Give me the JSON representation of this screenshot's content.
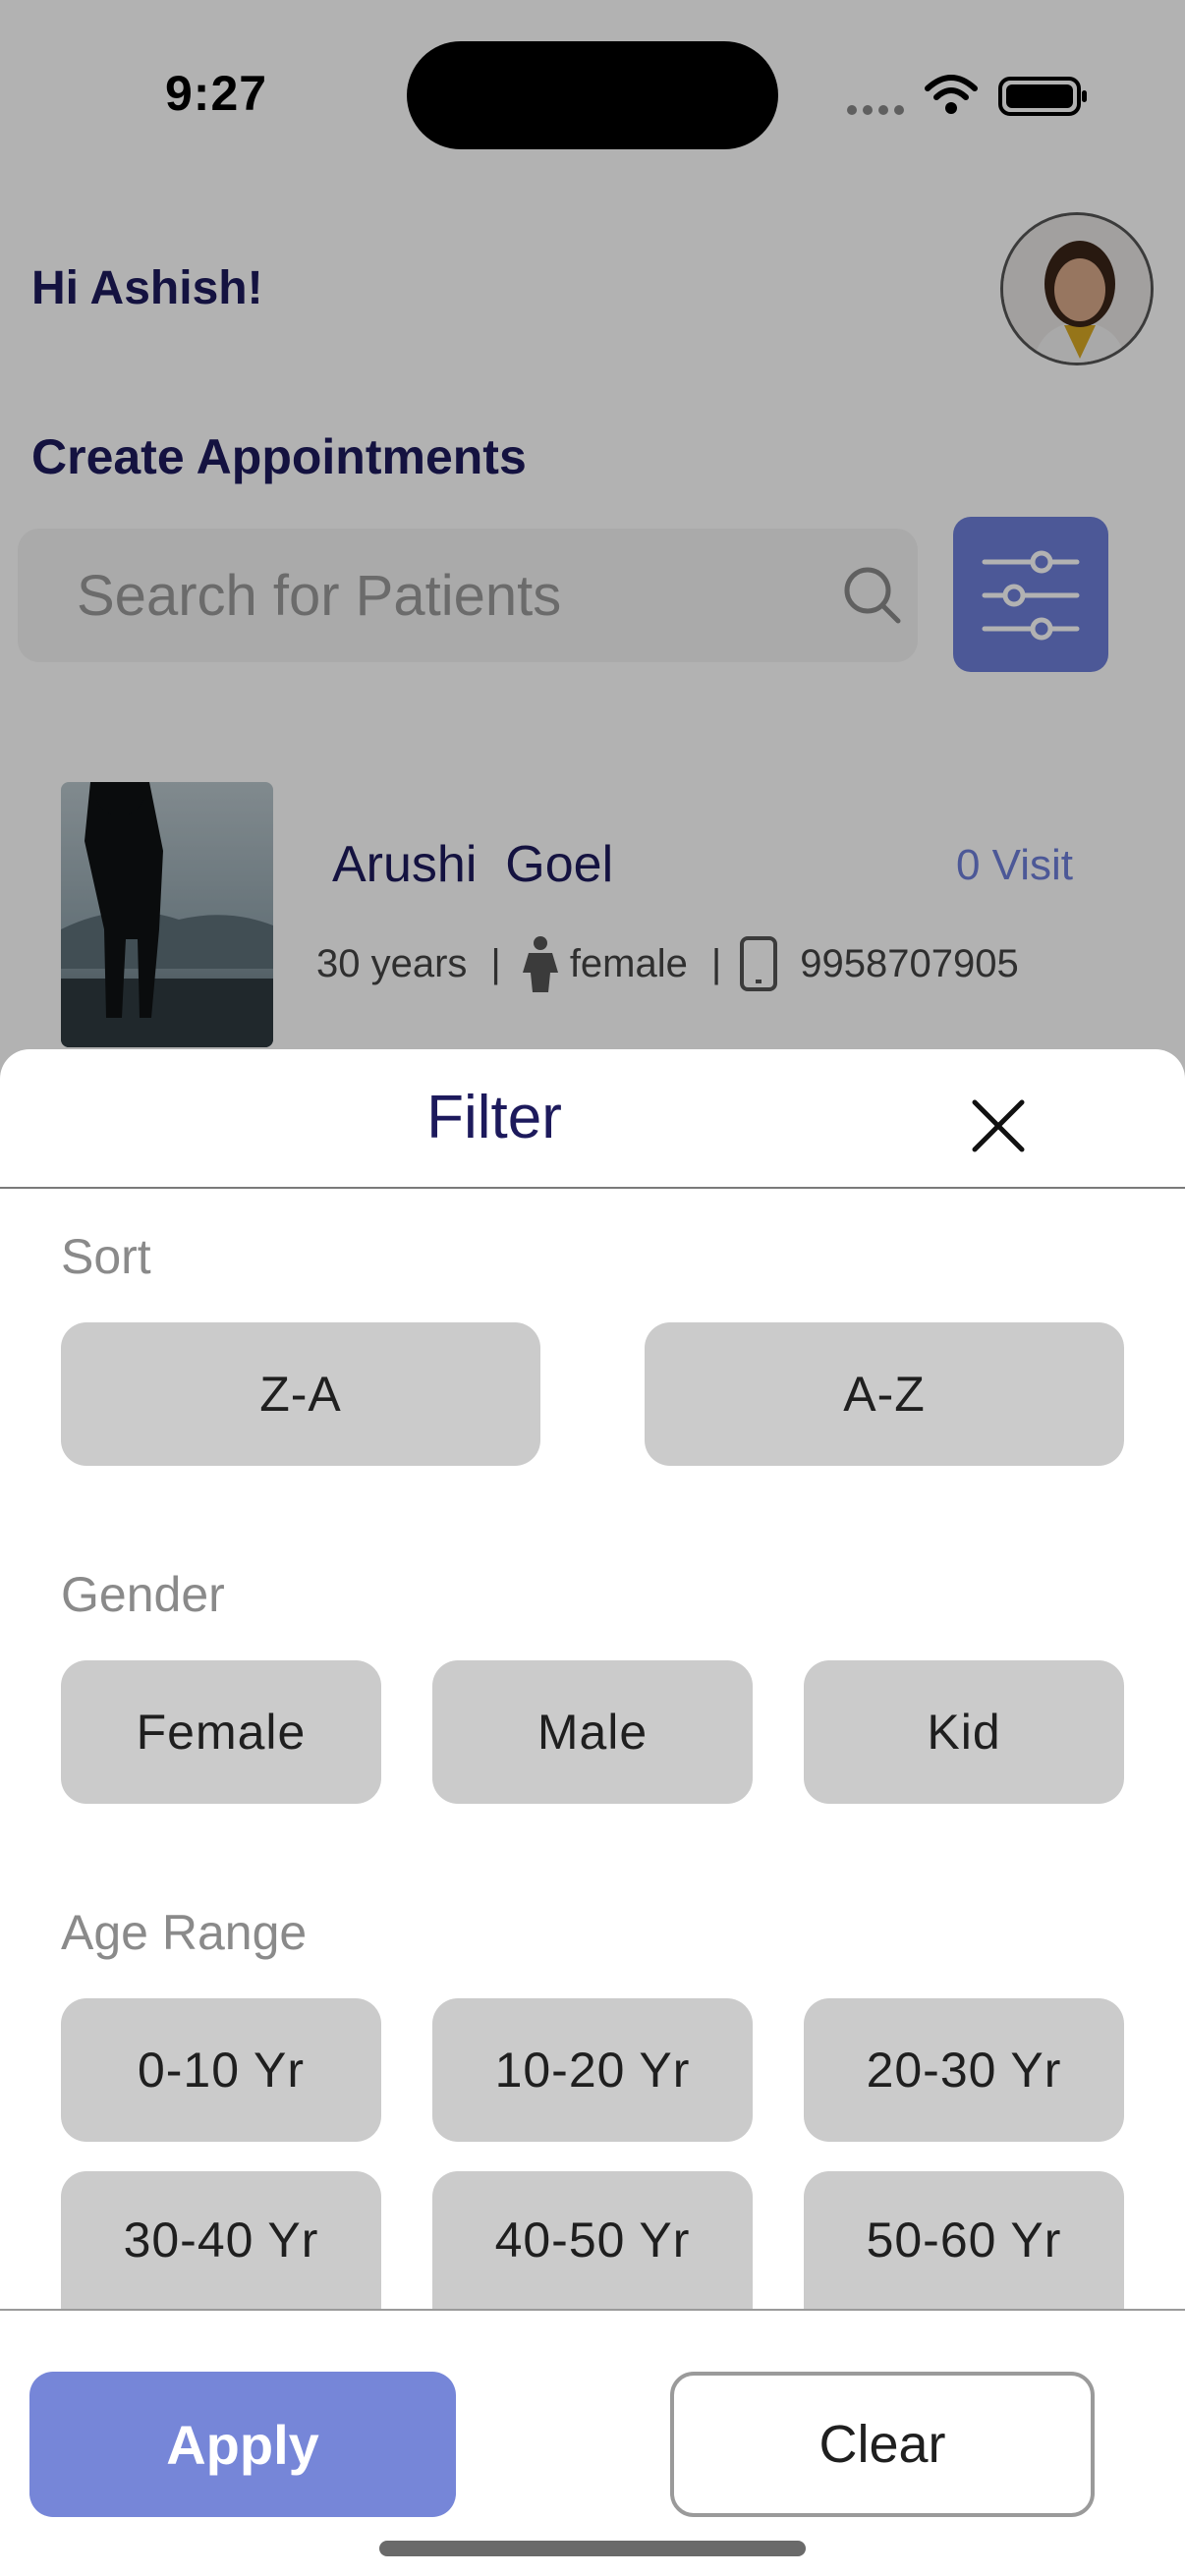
{
  "status_bar": {
    "time": "9:27"
  },
  "header": {
    "greeting": "Hi Ashish!",
    "section_title": "Create Appointments"
  },
  "search": {
    "placeholder": "Search for Patients"
  },
  "patient": {
    "name": "Arushi  Goel",
    "visits": "0 Visit",
    "age": "30 years",
    "gender": "female",
    "phone": "9958707905"
  },
  "filter_sheet": {
    "title": "Filter",
    "sort": {
      "label": "Sort",
      "options": [
        "Z-A",
        "A-Z"
      ]
    },
    "gender": {
      "label": "Gender",
      "options": [
        "Female",
        "Male",
        "Kid"
      ]
    },
    "age_range": {
      "label": "Age Range",
      "options": [
        "0-10 Yr",
        "10-20 Yr",
        "20-30 Yr",
        "30-40 Yr",
        "40-50 Yr",
        "50-60 Yr"
      ]
    },
    "apply_label": "Apply",
    "clear_label": "Clear"
  },
  "colors": {
    "accent": "#6e7fd8",
    "title": "#1d1a5c",
    "chip": "#cbcbcb"
  }
}
